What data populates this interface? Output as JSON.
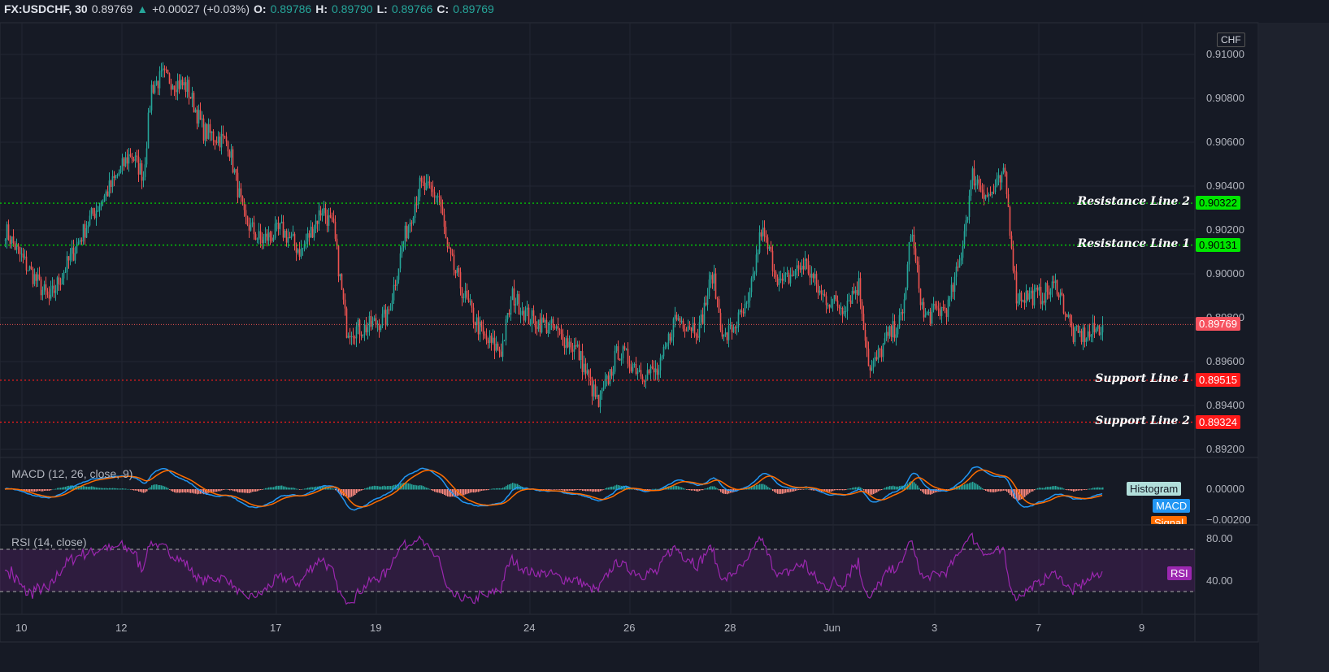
{
  "header": {
    "symbol": "FX:USDCHF, 30",
    "last": "0.89769",
    "change": "+0.00027 (+0.03%)",
    "o_label": "O:",
    "o": "0.89786",
    "h_label": "H:",
    "h": "0.89790",
    "l_label": "L:",
    "l": "0.89766",
    "c_label": "C:",
    "c": "0.89769"
  },
  "colors": {
    "up": "#26a69a",
    "down": "#ef5350",
    "resistance": "#00e600",
    "support": "#ff1a1a",
    "macd": "#2196f3",
    "signal": "#ff6d00",
    "rsi": "#9c27b0",
    "background": "#161a25"
  },
  "chart_data": [
    {
      "type": "candlestick",
      "currency": "CHF",
      "ylim": [
        0.891,
        0.911
      ],
      "y_ticks": [
        "0.91000",
        "0.90800",
        "0.90600",
        "0.90400",
        "0.90200",
        "0.90000",
        "0.89800",
        "0.89600",
        "0.89400",
        "0.89200"
      ],
      "x_ticks": [
        "10",
        "12",
        "17",
        "19",
        "24",
        "26",
        "28",
        "Jun",
        "3",
        "7",
        "9"
      ],
      "price_path_bar_close": [
        [
          0,
          0.902
        ],
        [
          12,
          0.9005
        ],
        [
          27,
          0.8988
        ],
        [
          42,
          0.901
        ],
        [
          52,
          0.9025
        ],
        [
          65,
          0.904
        ],
        [
          77,
          0.9055
        ],
        [
          85,
          0.9045
        ],
        [
          90,
          0.9085
        ],
        [
          97,
          0.909
        ],
        [
          112,
          0.9085
        ],
        [
          122,
          0.9065
        ],
        [
          137,
          0.906
        ],
        [
          147,
          0.9025
        ],
        [
          157,
          0.9015
        ],
        [
          170,
          0.902
        ],
        [
          182,
          0.901
        ],
        [
          195,
          0.903
        ],
        [
          202,
          0.902
        ],
        [
          210,
          0.8975
        ],
        [
          220,
          0.8975
        ],
        [
          235,
          0.898
        ],
        [
          245,
          0.9015
        ],
        [
          255,
          0.904
        ],
        [
          267,
          0.9035
        ],
        [
          272,
          0.901
        ],
        [
          285,
          0.8985
        ],
        [
          295,
          0.897
        ],
        [
          305,
          0.8965
        ],
        [
          312,
          0.899
        ],
        [
          322,
          0.898
        ],
        [
          337,
          0.8975
        ],
        [
          352,
          0.8965
        ],
        [
          365,
          0.894
        ],
        [
          377,
          0.8965
        ],
        [
          392,
          0.8955
        ],
        [
          402,
          0.8955
        ],
        [
          412,
          0.898
        ],
        [
          427,
          0.8975
        ],
        [
          435,
          0.9
        ],
        [
          442,
          0.897
        ],
        [
          457,
          0.8985
        ],
        [
          465,
          0.902
        ],
        [
          477,
          0.8995
        ],
        [
          492,
          0.9005
        ],
        [
          502,
          0.899
        ],
        [
          515,
          0.8985
        ],
        [
          525,
          0.8995
        ],
        [
          532,
          0.8955
        ],
        [
          542,
          0.897
        ],
        [
          552,
          0.898
        ],
        [
          557,
          0.902
        ],
        [
          565,
          0.898
        ],
        [
          580,
          0.8985
        ],
        [
          587,
          0.9005
        ],
        [
          595,
          0.9045
        ],
        [
          605,
          0.9035
        ],
        [
          615,
          0.9045
        ],
        [
          622,
          0.899
        ],
        [
          637,
          0.899
        ],
        [
          647,
          0.8995
        ],
        [
          657,
          0.8972
        ],
        [
          667,
          0.8972
        ],
        [
          675,
          0.89769
        ]
      ],
      "last_price": "0.89769",
      "levels": [
        {
          "name": "Resistance Line 2",
          "value": "0.90322",
          "kind": "resistance"
        },
        {
          "name": "Resistance Line 1",
          "value": "0.90131",
          "kind": "resistance"
        },
        {
          "name": "Support Line 1",
          "value": "0.89515",
          "kind": "support"
        },
        {
          "name": "Support Line 2",
          "value": "0.89324",
          "kind": "support"
        }
      ]
    },
    {
      "type": "line",
      "title": "MACD (12, 26, close, 9)",
      "y_ticks": [
        "0.00000",
        "−0.00200"
      ],
      "legend": [
        "Histogram",
        "MACD",
        "Signal"
      ]
    },
    {
      "type": "line",
      "title": "RSI (14, close)",
      "y_ticks": [
        "80.00",
        "40.00"
      ],
      "bands": [
        70,
        30
      ],
      "legend": [
        "RSI"
      ]
    }
  ]
}
